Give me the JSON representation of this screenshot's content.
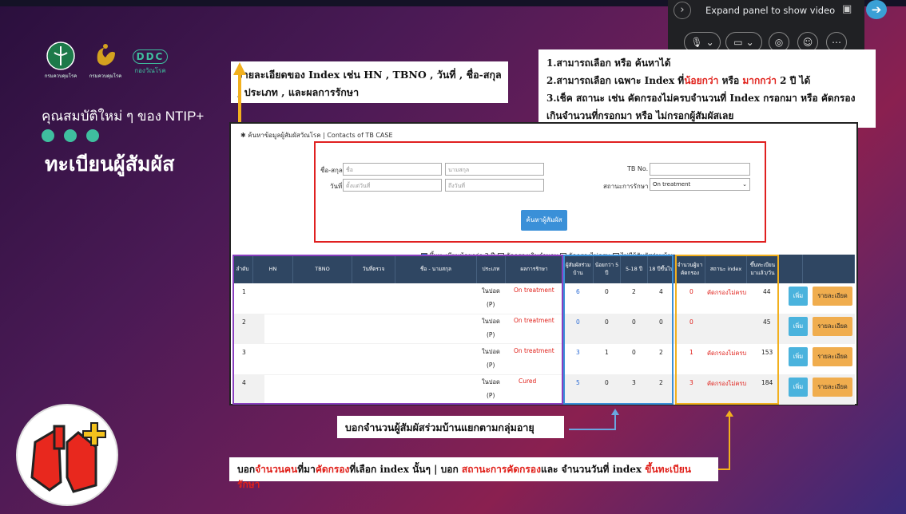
{
  "slide": {
    "subtitle": "คุณสมบัติใหม่ ๆ ของ NTIP+",
    "title": "ทะเบียนผู้สัมผัส",
    "logos": [
      {
        "icon": "ministry-logo-icon",
        "caption": "กรมควบคุมโรค"
      },
      {
        "icon": "anniversary-logo-icon",
        "caption": "กรมควบคุมโรค"
      },
      {
        "icon": "ddc-logo-icon",
        "text": "DDC",
        "caption": "กองวัณโรค"
      }
    ],
    "accent_color": "#3fbf9f"
  },
  "callouts": {
    "index_detail": "รายละเอียดของ Index เช่น HN , TBNO , วันที่ , ชื่อ-สกุล , ประเภท , และผลการรักษา",
    "features_1": "1.สามารถเลือก หรือ ค้นหาได้",
    "features_2a": "2.สามารถเลือก เฉพาะ Index ที่",
    "features_2b": "น้อยกว่า",
    "features_2c": " หรือ ",
    "features_2d": "มากกว่า",
    "features_2e": " 2 ปี ได้",
    "features_3": "3.เช็ค สถานะ เช่น คัดกรองไม่ครบจำนวนที่ Index กรอกมา หรือ คัดกรองเกินจำนวนที่กรอกมา หรือ ไม่กรอกผู้สัมผัสเลย",
    "household": "บอกจำนวนผู้สัมผัสร่วมบ้านแยกตามกลุ่มอายุ",
    "screen_a": "บอก",
    "screen_b": "จำนวนคน",
    "screen_c": "ที่มา",
    "screen_d": "คัดกรอง",
    "screen_e": "ที่เลือก index นั้นๆ |  บอก ",
    "screen_f": "สถานะการคัดกรอง",
    "screen_g": "และ จำนวนวันที่ index ",
    "screen_h": "ขึ้นทะเบียนรักษา"
  },
  "meet": {
    "expand_label": "Expand panel to show video",
    "icons": [
      "chevron-right-icon",
      "picture-in-picture-icon",
      "mic-icon",
      "camera-icon",
      "record-icon",
      "people-icon",
      "more-icon",
      "share-arrow-icon"
    ]
  },
  "search": {
    "title": "ค้นหาข้อมูลผู้สัมผัสวัณโรค | Contacts of TB CASE",
    "name_label": "ชื่อ-สกุล",
    "first_placeholder": "ชื่อ",
    "last_placeholder": "นามสกุล",
    "date_label": "วันที่",
    "from_placeholder": "ตั้งแต่วันที่",
    "to_placeholder": "ถึงวันที่",
    "tbno_label": "TB No.",
    "status_label": "สถานะการรักษา",
    "status_value": "On treatment",
    "button": "ค้นหาผู้สัมผัส",
    "checks": [
      {
        "label": "ขึ้นทะเบียนน้อยกว่า 2 ปี",
        "checked": true
      },
      {
        "label": "คัดกรองเกินจำนวน",
        "checked": false
      },
      {
        "label": "คัดกรองไม่ครบ",
        "checked": false
      },
      {
        "label": "ไม่มีผู้สัมผัสร่วมบ้าน",
        "checked": false
      }
    ]
  },
  "table": {
    "headers": {
      "no": "ลำดับ",
      "hn": "HN",
      "tbno": "TBNO",
      "date": "วันที่ตรวจ",
      "name": "ชื่อ - นามสกุล",
      "type": "ประเภท",
      "result": "ผลการรักษา",
      "household": "ผู้สัมผัสร่วมบ้าน",
      "lt5": "น้อยกว่า 5 ปี",
      "age5_18": "5-18 ปี",
      "gt18": "18 ปีขึ้นไป",
      "screened": "จำนวนผู้มาคัดกรอง",
      "status": "สถานะ index",
      "days": "ขึ้นทะเบียนมาแล้ว/วัน"
    },
    "add_label": "เพิ่ม",
    "detail_label": "รายละเอียด",
    "rows": [
      {
        "no": "1",
        "type": "ในปอด",
        "type2": "(P)",
        "result": "On treatment",
        "household": "6",
        "lt5": "0",
        "age5_18": "2",
        "gt18": "4",
        "screened": "0",
        "status": "คัดกรองไม่ครบ",
        "days": "44"
      },
      {
        "no": "2",
        "type": "ในปอด",
        "type2": "(P)",
        "result": "On treatment",
        "household": "0",
        "lt5": "0",
        "age5_18": "0",
        "gt18": "0",
        "screened": "0",
        "status": "",
        "days": "45"
      },
      {
        "no": "3",
        "type": "ในปอด",
        "type2": "(P)",
        "result": "On treatment",
        "household": "3",
        "lt5": "1",
        "age5_18": "0",
        "gt18": "2",
        "screened": "1",
        "status": "คัดกรองไม่ครบ",
        "days": "153"
      },
      {
        "no": "4",
        "type": "ในปอด",
        "type2": "(P)",
        "result": "Cured",
        "household": "5",
        "lt5": "0",
        "age5_18": "3",
        "gt18": "2",
        "screened": "3",
        "status": "คัดกรองไม่ครบ",
        "days": "184"
      }
    ]
  }
}
